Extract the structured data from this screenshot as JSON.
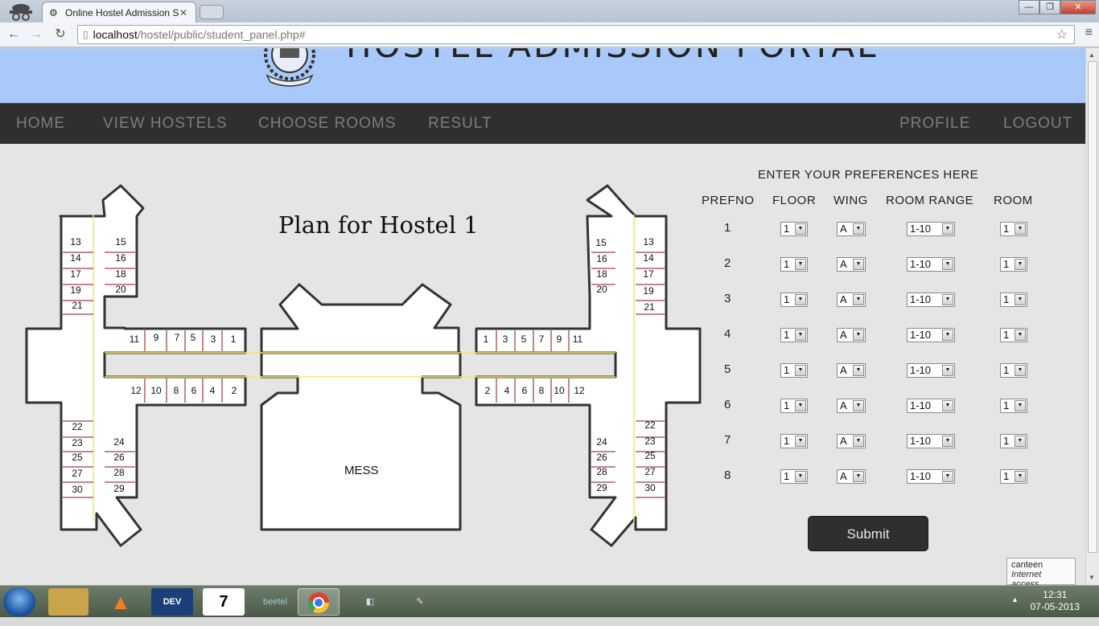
{
  "browser": {
    "tab_title": "Online Hostel Admission S",
    "url_host": "localhost",
    "url_path": "/hostel/public/student_panel.php#"
  },
  "header": {
    "title": "HOSTEL ADMISSION PORTAL"
  },
  "nav": {
    "home": "HOME",
    "view_hostels": "VIEW HOSTELS",
    "choose_rooms": "CHOOSE ROOMS",
    "result": "RESULT",
    "profile": "PROFILE",
    "logout": "LOGOUT"
  },
  "plan": {
    "title": "Plan for Hostel 1",
    "mess_label": "MESS",
    "rooms": [
      "13",
      "15",
      "14",
      "16",
      "17",
      "18",
      "19",
      "20",
      "21",
      "11",
      "9",
      "7",
      "5",
      "3",
      "1",
      "12",
      "10",
      "8",
      "6",
      "4",
      "2",
      "22",
      "23",
      "24",
      "25",
      "26",
      "27",
      "28",
      "30",
      "29",
      "1",
      "3",
      "5",
      "7",
      "9",
      "11",
      "2",
      "4",
      "6",
      "8",
      "10",
      "12",
      "15",
      "13",
      "16",
      "14",
      "18",
      "17",
      "20",
      "19",
      "21",
      "22",
      "24",
      "23",
      "26",
      "25",
      "28",
      "27",
      "29",
      "30"
    ]
  },
  "preferences": {
    "heading": "ENTER YOUR PREFERENCES HERE",
    "columns": [
      "PREFNO",
      "FLOOR",
      "WING",
      "ROOM RANGE",
      "ROOM"
    ],
    "rows": [
      {
        "no": "1",
        "floor": "1",
        "wing": "A",
        "range": "1-10",
        "room": "1"
      },
      {
        "no": "2",
        "floor": "1",
        "wing": "A",
        "range": "1-10",
        "room": "1"
      },
      {
        "no": "3",
        "floor": "1",
        "wing": "A",
        "range": "1-10",
        "room": "1"
      },
      {
        "no": "4",
        "floor": "1",
        "wing": "A",
        "range": "1-10",
        "room": "1"
      },
      {
        "no": "5",
        "floor": "1",
        "wing": "A",
        "range": "1-10",
        "room": "1"
      },
      {
        "no": "6",
        "floor": "1",
        "wing": "A",
        "range": "1-10",
        "room": "1"
      },
      {
        "no": "7",
        "floor": "1",
        "wing": "A",
        "range": "1-10",
        "room": "1"
      },
      {
        "no": "8",
        "floor": "1",
        "wing": "A",
        "range": "1-10",
        "room": "1"
      }
    ],
    "submit_label": "Submit"
  },
  "network_tooltip": {
    "name": "canteen",
    "status": "Internet access"
  },
  "taskbar": {
    "time": "12:31",
    "date": "07-05-2013"
  },
  "colors": {
    "header_bg": "#a9c9fb",
    "nav_bg": "#2f2f2f",
    "nav_text": "#7d7d7d"
  }
}
